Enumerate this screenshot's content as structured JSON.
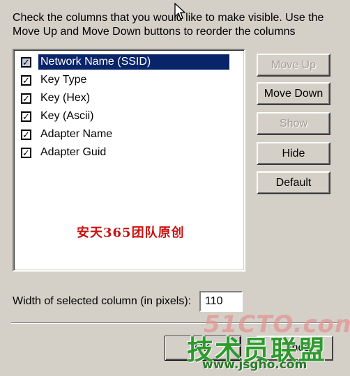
{
  "instructions": "Check the columns that you would like to make visible. Use the Move Up and Move Down buttons to reorder the columns",
  "columns": [
    {
      "label": "Network Name (SSID)",
      "checked": true,
      "selected": true
    },
    {
      "label": "Key Type",
      "checked": true,
      "selected": false
    },
    {
      "label": "Key (Hex)",
      "checked": true,
      "selected": false
    },
    {
      "label": "Key (Ascii)",
      "checked": true,
      "selected": false
    },
    {
      "label": "Adapter Name",
      "checked": true,
      "selected": false
    },
    {
      "label": "Adapter Guid",
      "checked": true,
      "selected": false
    }
  ],
  "buttons": {
    "move_up": "Move Up",
    "move_down": "Move Down",
    "show": "Show",
    "hide": "Hide",
    "default": "Default"
  },
  "width_field": {
    "label": "Width of selected column (in pixels):",
    "value": "110"
  },
  "footer": {
    "ok_label": "OK",
    "cancel_label": "Cancel"
  },
  "watermarks": {
    "overlay_text": "安天365团队原创",
    "site": "51CTO.com",
    "site_cn": "技术员联盟",
    "url": "www.jsgho.com"
  },
  "colors": {
    "dialog_bg": "#d4d0c8",
    "selection": "#0a246a",
    "watermark_red": "#cc1010",
    "watermark_green": "#2e9a2e"
  }
}
